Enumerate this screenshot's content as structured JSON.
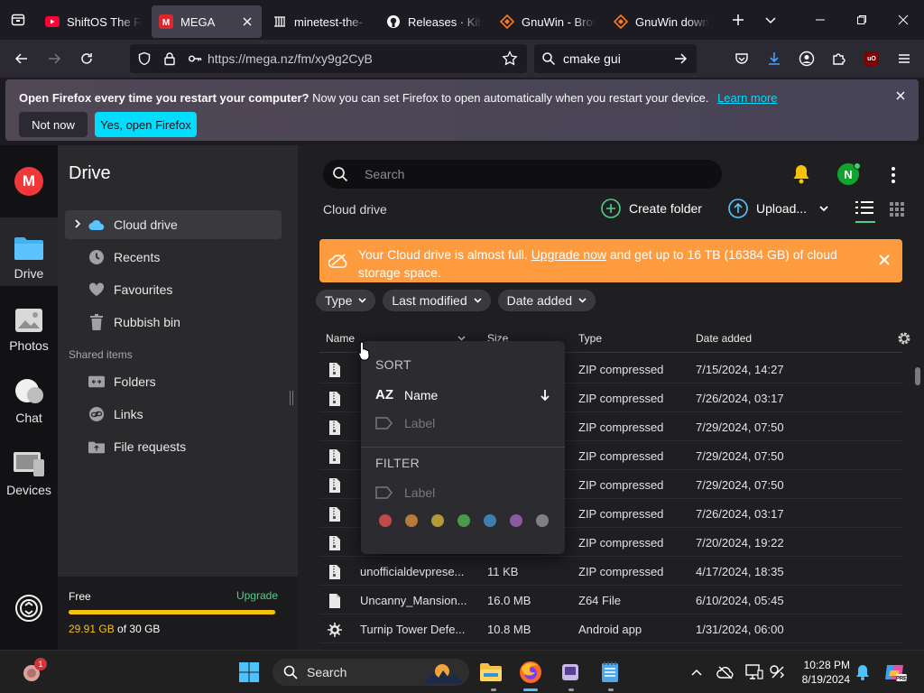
{
  "browser": {
    "tabs": [
      {
        "title": "ShiftOS The Ra",
        "active": false
      },
      {
        "title": "MEGA",
        "active": true
      },
      {
        "title": "minetest-the-",
        "active": false
      },
      {
        "title": "Releases · Kitw",
        "active": false
      },
      {
        "title": "GnuWin - Brov",
        "active": false
      },
      {
        "title": "GnuWin down",
        "active": false
      }
    ],
    "url": "https://mega.nz/fm/xy9g2CyB",
    "search_query": "cmake gui",
    "extension_badge": "uO"
  },
  "notification": {
    "bold": "Open Firefox every time you restart your computer?",
    "text": "Now you can set Firefox to open automatically when you restart your device.",
    "link": "Learn more",
    "btn_no": "Not now",
    "btn_yes": "Yes, open Firefox"
  },
  "rail": {
    "logo": "M",
    "items": [
      {
        "label": "Drive",
        "icon": "folder-icon",
        "active": true
      },
      {
        "label": "Photos",
        "icon": "photos-icon",
        "active": false
      },
      {
        "label": "Chat",
        "icon": "chat-icon",
        "active": false
      },
      {
        "label": "Devices",
        "icon": "devices-icon",
        "active": false
      }
    ]
  },
  "sidebar": {
    "title": "Drive",
    "items": [
      {
        "label": "Cloud drive",
        "icon": "cloud-icon"
      },
      {
        "label": "Recents",
        "icon": "clock-icon"
      },
      {
        "label": "Favourites",
        "icon": "heart-icon"
      },
      {
        "label": "Rubbish bin",
        "icon": "trash-icon"
      }
    ],
    "shared_heading": "Shared items",
    "shared": [
      {
        "label": "Folders",
        "icon": "shared-folder-icon"
      },
      {
        "label": "Links",
        "icon": "link-icon"
      },
      {
        "label": "File requests",
        "icon": "file-request-icon"
      }
    ],
    "storage": {
      "plan": "Free",
      "upgrade": "Upgrade",
      "used": "29.91 GB",
      "of": "of 30 GB",
      "fraction": 0.997
    }
  },
  "main": {
    "search_placeholder": "Search",
    "avatar_letter": "N",
    "breadcrumb": "Cloud drive",
    "create_folder": "Create folder",
    "upload": "Upload...",
    "banner": {
      "pre": "Your Cloud drive is almost full.",
      "link": "Upgrade now",
      "post": "and get up to 16 TB (16384 GB) of cloud storage space."
    },
    "filters": [
      "Type",
      "Last modified",
      "Date added"
    ],
    "columns": {
      "name": "Name",
      "size": "Size",
      "type": "Type",
      "date": "Date added"
    },
    "rows": [
      {
        "name": "",
        "size": "",
        "type": "ZIP compressed",
        "date": "7/15/2024, 14:27",
        "icon": "zip-file-icon"
      },
      {
        "name": "",
        "size": "",
        "type": "ZIP compressed",
        "date": "7/26/2024, 03:17",
        "icon": "zip-file-icon"
      },
      {
        "name": "",
        "size": "",
        "type": "ZIP compressed",
        "date": "7/29/2024, 07:50",
        "icon": "zip-file-icon"
      },
      {
        "name": "",
        "size": "",
        "type": "ZIP compressed",
        "date": "7/29/2024, 07:50",
        "icon": "zip-file-icon"
      },
      {
        "name": "",
        "size": "",
        "type": "ZIP compressed",
        "date": "7/29/2024, 07:50",
        "icon": "zip-file-icon"
      },
      {
        "name": "",
        "size": "",
        "type": "ZIP compressed",
        "date": "7/26/2024, 03:17",
        "icon": "zip-file-icon"
      },
      {
        "name": "",
        "size": "",
        "type": "ZIP compressed",
        "date": "7/20/2024, 19:22",
        "icon": "zip-file-icon"
      },
      {
        "name": "unofficialdevprese...",
        "size": "11 KB",
        "type": "ZIP compressed",
        "date": "4/17/2024, 18:35",
        "icon": "zip-file-icon"
      },
      {
        "name": "Uncanny_Mansion...",
        "size": "16.0 MB",
        "type": "Z64 File",
        "date": "6/10/2024, 05:45",
        "icon": "generic-file-icon"
      },
      {
        "name": "Turnip Tower Defe...",
        "size": "10.8 MB",
        "type": "Android app",
        "date": "1/31/2024, 06:00",
        "icon": "android-file-icon"
      }
    ]
  },
  "sort_popup": {
    "sort_heading": "SORT",
    "name_option": "Name",
    "name_prefix": "AZ",
    "label_option": "Label",
    "filter_heading": "FILTER",
    "filter_label": "Label",
    "colors": [
      "#c04a4a",
      "#b67a3a",
      "#b29a3a",
      "#4a9a4a",
      "#3f7fb0",
      "#8a5aa0",
      "#808080"
    ]
  },
  "taskbar": {
    "search": "Search",
    "notification_count": "1",
    "time": "10:28 PM",
    "date": "8/19/2024"
  }
}
